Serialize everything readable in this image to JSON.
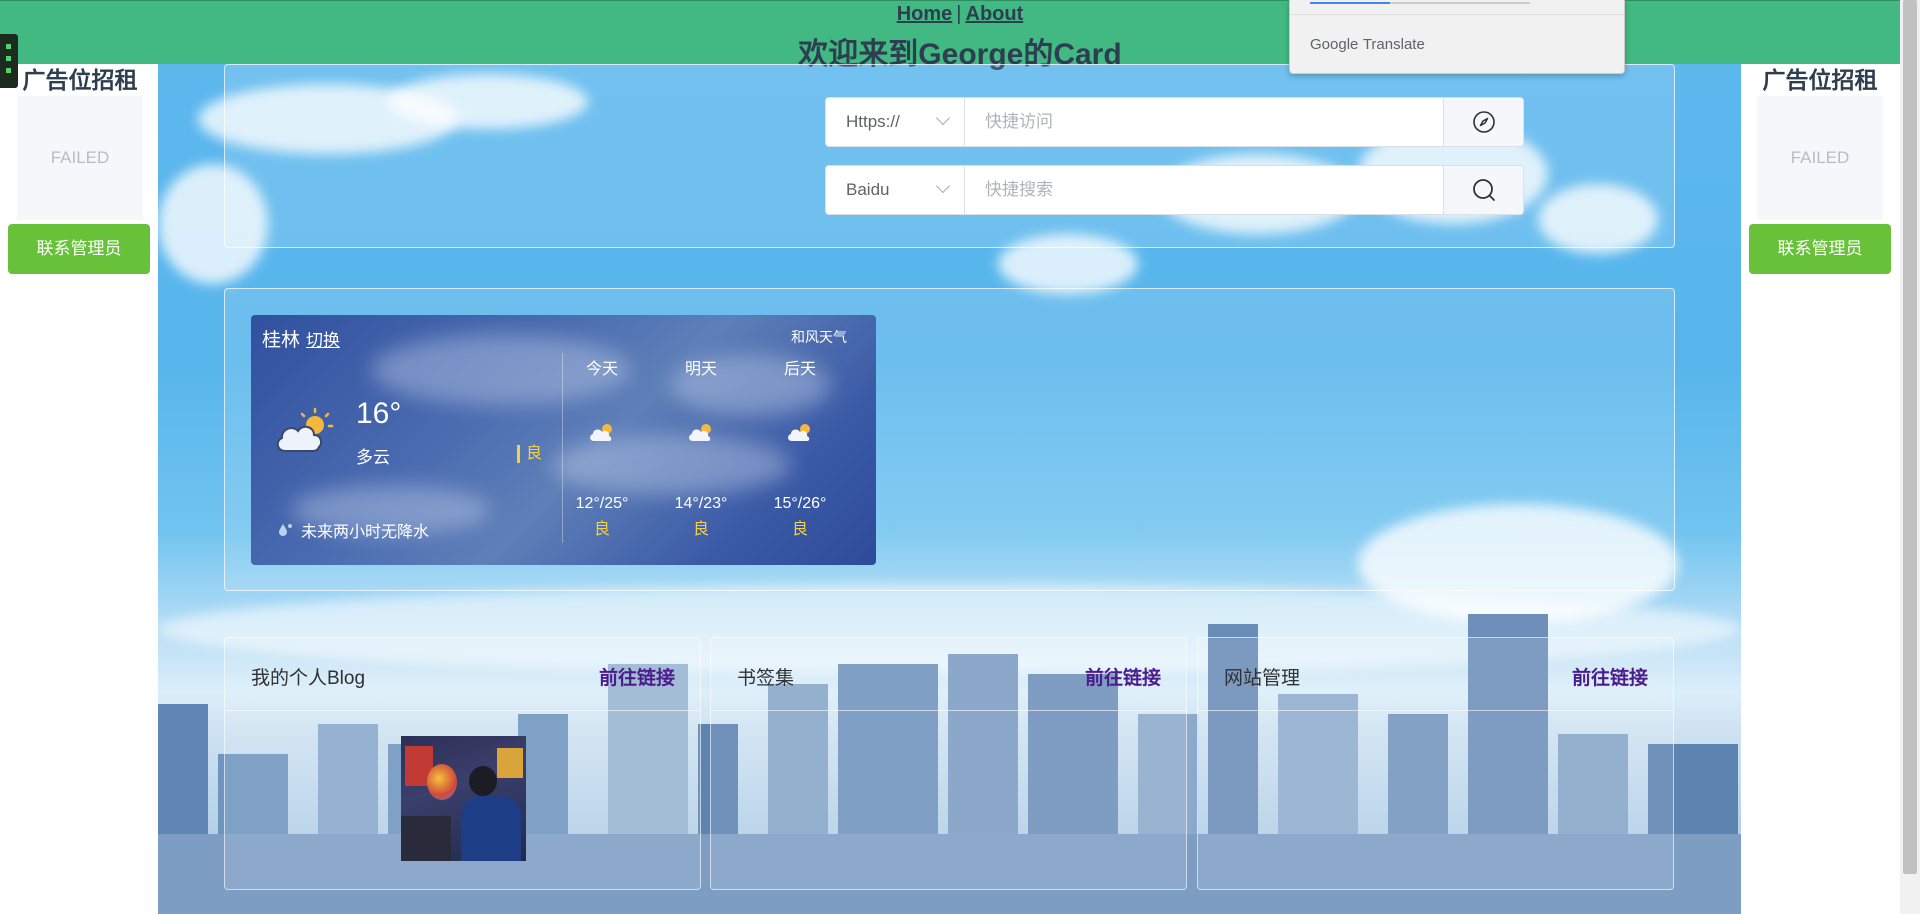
{
  "header": {
    "nav": {
      "home": "Home",
      "separator": "|",
      "about": "About"
    },
    "title": "欢迎来到George的Card",
    "bg_color": "#42b983"
  },
  "translate_popup": {
    "google": "Google",
    "translate": "Translate"
  },
  "ads": {
    "left": {
      "title": "广告位招租",
      "image_status": "FAILED",
      "button": "联系管理员"
    },
    "right": {
      "title": "广告位招租",
      "image_status": "FAILED",
      "button": "联系管理员"
    }
  },
  "search": {
    "url_row": {
      "protocol": "Https://",
      "placeholder": "快捷访问",
      "button_icon": "compass-icon"
    },
    "search_row": {
      "engine": "Baidu",
      "placeholder": "快捷搜索",
      "button_icon": "search-icon"
    }
  },
  "weather": {
    "city": "桂林",
    "switch_label": "切换",
    "brand": "和风天气",
    "current": {
      "temp": "16°",
      "desc": "多云",
      "aqi": "良",
      "icon": "partly-cloudy-icon"
    },
    "precip": "未来两小时无降水",
    "forecast": [
      {
        "label": "今天",
        "range": "12°/25°",
        "aqi": "良",
        "icon": "partly-cloudy-icon"
      },
      {
        "label": "明天",
        "range": "14°/23°",
        "aqi": "良",
        "icon": "partly-cloudy-icon"
      },
      {
        "label": "后天",
        "range": "15°/26°",
        "aqi": "良",
        "icon": "partly-cloudy-icon"
      }
    ]
  },
  "cards": [
    {
      "title": "我的个人Blog",
      "link": "前往链接"
    },
    {
      "title": "书签集",
      "link": "前往链接"
    },
    {
      "title": "网站管理",
      "link": "前往链接"
    }
  ],
  "colors": {
    "ad_button": "#67c23a",
    "link": "#4b1d8c",
    "aqi_good": "#f5d142"
  }
}
